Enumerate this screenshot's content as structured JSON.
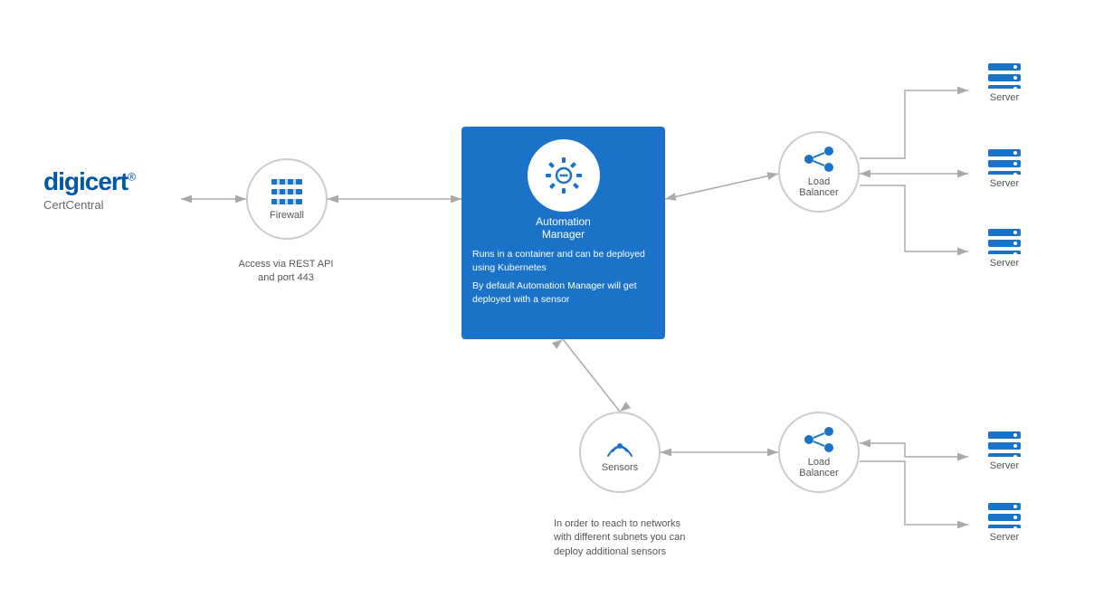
{
  "logo": {
    "brand": "digicert",
    "trademark": "®",
    "product": "CertCentral"
  },
  "nodes": {
    "firewall": {
      "label": "Firewall",
      "access_text": "Access via REST API\nand port 443"
    },
    "automation_manager": {
      "title": "Automation\nManager",
      "desc1": "Runs in a container and can be deployed using Kubernetes",
      "desc2": "By default Automation Manager will get deployed with a sensor"
    },
    "load_balancer_top": {
      "label": "Load\nBalancer"
    },
    "load_balancer_bottom": {
      "label": "Load\nBalancer"
    },
    "sensors": {
      "label": "Sensors"
    },
    "servers_top": [
      "Server",
      "Server",
      "Server"
    ],
    "servers_bottom": [
      "Server",
      "Server"
    ]
  },
  "sensor_description": "In order to reach to networks with different subnets you can deploy additional sensors"
}
